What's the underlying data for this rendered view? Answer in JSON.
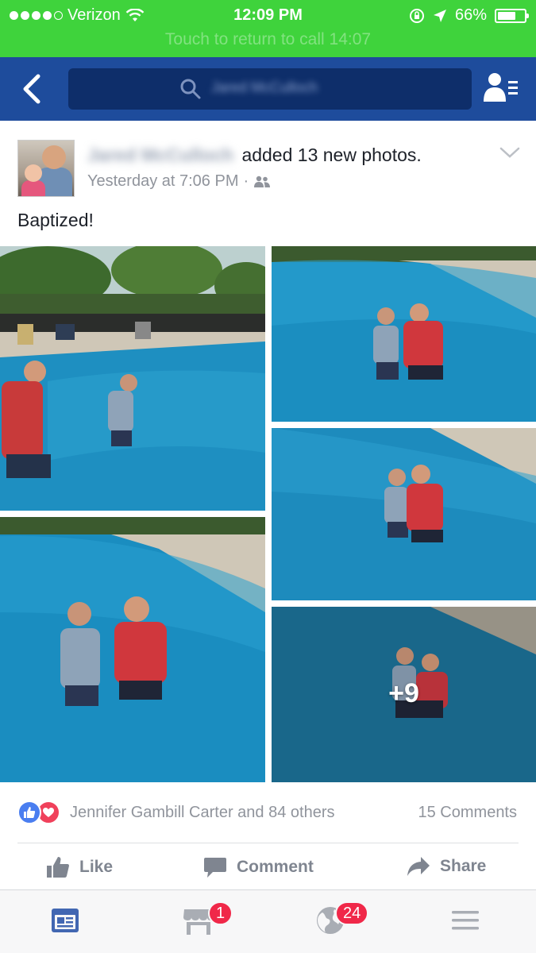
{
  "status_bar": {
    "carrier": "Verizon",
    "time": "12:09 PM",
    "battery": "66%",
    "call_banner": "Touch to return to call  14:07"
  },
  "header": {
    "search_text": "Jared McCulloch"
  },
  "post": {
    "author": "Jared McCulloch",
    "action_text": "added 13 new photos.",
    "timestamp": "Yesterday at 7:06 PM",
    "separator": "·",
    "caption": "Baptized!",
    "more_photos": "+9"
  },
  "reactions": {
    "names": "Jennifer Gambill Carter and 84 others",
    "comments": "15 Comments"
  },
  "actions": {
    "like": "Like",
    "comment": "Comment",
    "share": "Share"
  },
  "tabbar": {
    "marketplace_badge": "1",
    "notifications_badge": "24"
  },
  "colors": {
    "status_green": "#3fd33c",
    "fb_blue": "#1e4c9c",
    "badge_red": "#f02849",
    "active_tab": "#4267b2"
  }
}
